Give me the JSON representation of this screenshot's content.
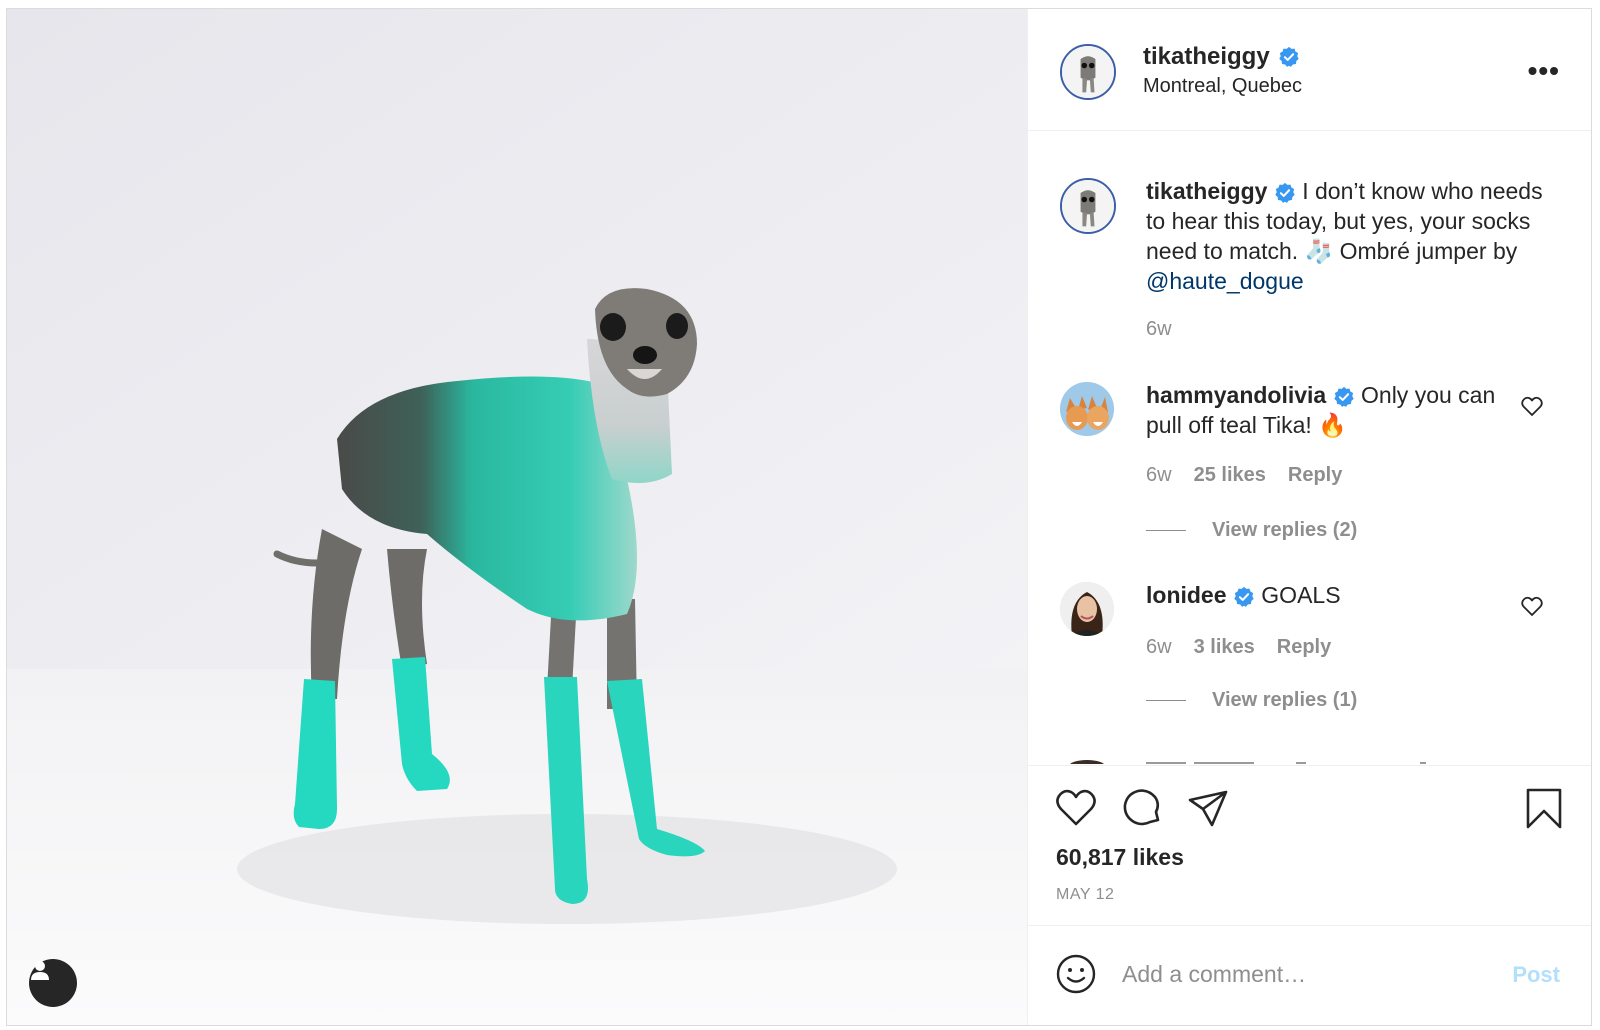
{
  "post": {
    "author": {
      "username": "tikatheiggy",
      "verified": true,
      "location": "Montreal, Quebec"
    },
    "more_label": "•••",
    "caption": {
      "username": "tikatheiggy",
      "text_line": " I don’t know who needs to hear this today, but yes, your socks need to match. 🧦 Ombré jumper by ",
      "mention": "@haute_dogue",
      "age": "6w"
    },
    "comments": [
      {
        "username": "hammyandolivia",
        "verified": true,
        "text": " Only you can pull off teal Tika! 🔥",
        "age": "6w",
        "likes": "25 likes",
        "reply_label": "Reply",
        "view_replies": "View replies (2)"
      },
      {
        "username": "lonidee",
        "verified": true,
        "text": " GOALS",
        "age": "6w",
        "likes": "3 likes",
        "reply_label": "Reply",
        "view_replies": "View replies (1)"
      }
    ],
    "icons": {
      "like": "heart-icon",
      "comment": "comment-bubble-icon",
      "share": "paper-plane-icon",
      "save": "bookmark-icon",
      "emoji": "smiley-icon",
      "user_tags": "person-icon"
    },
    "likes_count": "60,817 likes",
    "date": "MAY 12",
    "comment_box": {
      "placeholder": "Add a comment…",
      "post_label": "Post"
    },
    "colors": {
      "sweater_teal": "#2ec9b0",
      "socks_teal": "#25d8c0",
      "verified_blue": "#3897f0",
      "link_blue": "#00376b",
      "post_button_disabled": "#b2dffc"
    }
  }
}
